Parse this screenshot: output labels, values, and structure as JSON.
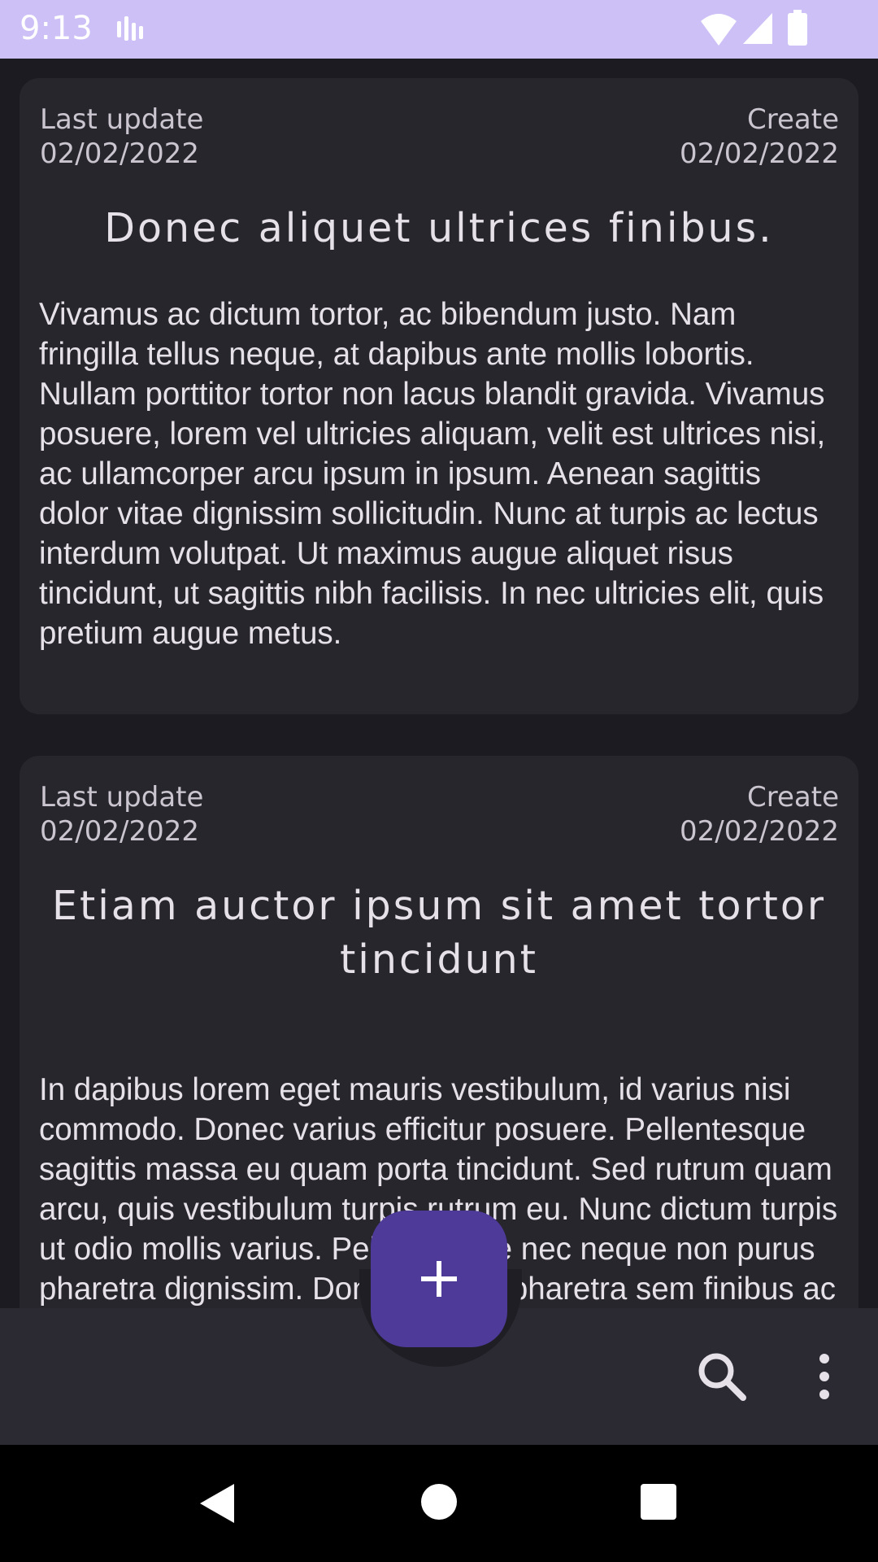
{
  "status_bar": {
    "time": "9:13",
    "icons": [
      "signal-bars-icon",
      "wifi-icon",
      "cellular-icon",
      "battery-icon"
    ]
  },
  "notes": [
    {
      "last_update_label": "Last update",
      "last_update_date": "02/02/2022",
      "create_label": "Create",
      "create_date": "02/02/2022",
      "title": "Donec aliquet ultrices finibus.",
      "body": "Vivamus ac dictum tortor, ac bibendum justo. Nam fringilla tellus neque, at dapibus ante mollis lobortis. Nullam porttitor tortor non lacus blandit gravida. Vivamus posuere, lorem vel ultricies aliquam, velit est ultrices nisi, ac ullamcorper arcu ipsum in ipsum. Aenean sagittis dolor vitae dignissim sollicitudin. Nunc at turpis ac lectus interdum volutpat. Ut maximus augue aliquet risus tincidunt, ut sagittis nibh facilisis. In nec ultricies elit, quis pretium augue metus."
    },
    {
      "last_update_label": "Last update",
      "last_update_date": "02/02/2022",
      "create_label": "Create",
      "create_date": "02/02/2022",
      "title": "Etiam auctor ipsum sit amet tortor tincidunt",
      "body": "In dapibus lorem eget mauris vestibulum, id varius nisi commodo. Donec varius efficitur posuere. Pellentesque sagittis massa eu quam porta tincidunt. Sed rutrum quam arcu, quis vestibulum turpis rutrum eu. Nunc dictum turpis ut odio mollis varius. Pellentesque nec neque non purus pharetra dignissim. Donec rutrum pharetra sem finibus ac aliquet lorem sollicitudin."
    }
  ],
  "bottom_bar": {
    "fab_icon": "plus-icon",
    "actions": [
      "search-icon",
      "more-vert-icon"
    ]
  },
  "nav_bar": {
    "buttons": [
      "back-icon",
      "home-icon",
      "recents-icon"
    ]
  },
  "colors": {
    "status_bar": "#cdc0f7",
    "background": "#1c1b21",
    "card": "#27262d",
    "fab": "#4e3a98",
    "bottom_bar": "#2b2a32"
  }
}
